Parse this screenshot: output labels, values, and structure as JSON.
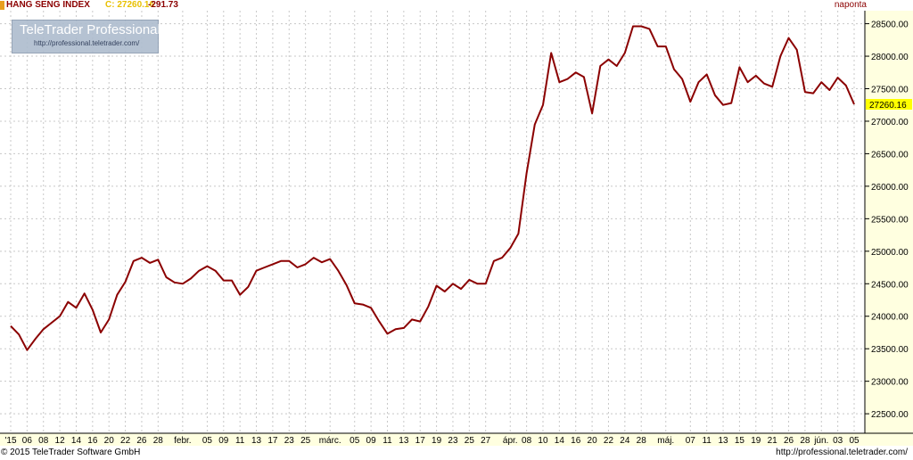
{
  "header": {
    "title": "HANG SENG INDEX",
    "close_label": "C: 27260.16",
    "change": "-291.73",
    "period": "naponta"
  },
  "logo": {
    "name": "TeleTrader Professional",
    "url": "http://professional.teletrader.com/"
  },
  "footer": {
    "copyright": "© 2015 TeleTrader Software GmbH",
    "url": "http://professional.teletrader.com/"
  },
  "colors": {
    "line": "#8b0000",
    "grid": "#c8c8c8",
    "axis_bg": "#ffffe0",
    "price_tag": "#ffff00"
  },
  "chart_data": {
    "type": "line",
    "title": "",
    "xlabel": "",
    "ylabel": "",
    "grid": true,
    "ylim": [
      22200,
      28700
    ],
    "last_value_label": "27260.16",
    "y_ticks": [
      22500,
      23000,
      23500,
      24000,
      24500,
      25000,
      25500,
      26000,
      26500,
      27000,
      27500,
      28000,
      28500
    ],
    "y_tick_labels": [
      "22500.00",
      "23000.00",
      "23500.00",
      "24000.00",
      "24500.00",
      "25000.00",
      "25500.00",
      "26000.00",
      "26500.00",
      "27000.00",
      "27500.00",
      "28000.00",
      "28500.00"
    ],
    "x_tick_labels": [
      "'15",
      "06",
      "08",
      "12",
      "14",
      "16",
      "20",
      "22",
      "26",
      "28",
      "febr.",
      "05",
      "09",
      "11",
      "13",
      "17",
      "23",
      "25",
      "márc.",
      "05",
      "09",
      "11",
      "13",
      "17",
      "19",
      "23",
      "25",
      "27",
      "ápr.",
      "08",
      "10",
      "14",
      "16",
      "20",
      "22",
      "24",
      "28",
      "máj.",
      "07",
      "11",
      "13",
      "15",
      "19",
      "21",
      "26",
      "28",
      "jún.",
      "03",
      "05"
    ],
    "x_tick_positions": [
      0,
      2,
      4,
      6,
      8,
      10,
      12,
      14,
      16,
      18,
      21,
      24,
      26,
      28,
      30,
      32,
      34,
      36,
      39,
      42,
      44,
      46,
      48,
      50,
      52,
      54,
      56,
      58,
      61,
      63,
      65,
      67,
      69,
      71,
      73,
      75,
      77,
      80,
      83,
      85,
      87,
      89,
      91,
      93,
      95,
      97,
      99,
      101,
      103
    ],
    "values": [
      23850,
      23720,
      23480,
      23650,
      23800,
      23900,
      24000,
      24220,
      24130,
      24350,
      24100,
      23750,
      23950,
      24330,
      24530,
      24850,
      24900,
      24820,
      24870,
      24600,
      24520,
      24500,
      24580,
      24700,
      24770,
      24700,
      24550,
      24550,
      24330,
      24450,
      24700,
      24750,
      24800,
      24850,
      24850,
      24750,
      24800,
      24900,
      24830,
      24880,
      24700,
      24480,
      24200,
      24180,
      24130,
      23920,
      23730,
      23800,
      23820,
      23950,
      23920,
      24150,
      24470,
      24380,
      24500,
      24420,
      24560,
      24500,
      24500,
      24850,
      24900,
      25050,
      25270,
      26200,
      26950,
      27250,
      28050,
      27600,
      27650,
      27750,
      27680,
      27120,
      27850,
      27950,
      27850,
      28050,
      28460,
      28460,
      28420,
      28150,
      28150,
      27800,
      27650,
      27300,
      27600,
      27720,
      27400,
      27250,
      27280,
      27830,
      27600,
      27700,
      27580,
      27530,
      28000,
      28280,
      28100,
      27450,
      27430,
      27600,
      27480,
      27670,
      27550,
      27260
    ]
  }
}
